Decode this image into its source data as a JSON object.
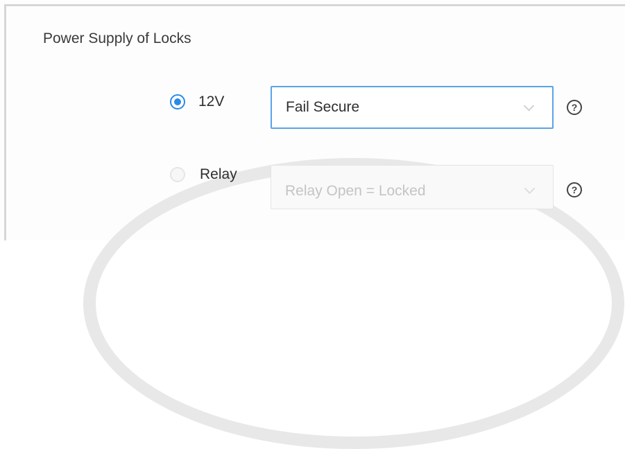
{
  "section": {
    "title": "Power Supply of Locks"
  },
  "options": {
    "twelve_v": {
      "label": "12V",
      "selected": true,
      "select_value": "Fail Secure"
    },
    "relay": {
      "label": "Relay",
      "selected": false,
      "select_value": "Relay Open = Locked"
    }
  },
  "help": {
    "glyph": "?"
  },
  "colors": {
    "accent": "#2a8ae6",
    "active_border": "#5aa3e8",
    "disabled_text": "#c4c4c4"
  },
  "icons": {
    "chevron": "chevron-down-icon",
    "help": "help-icon"
  }
}
